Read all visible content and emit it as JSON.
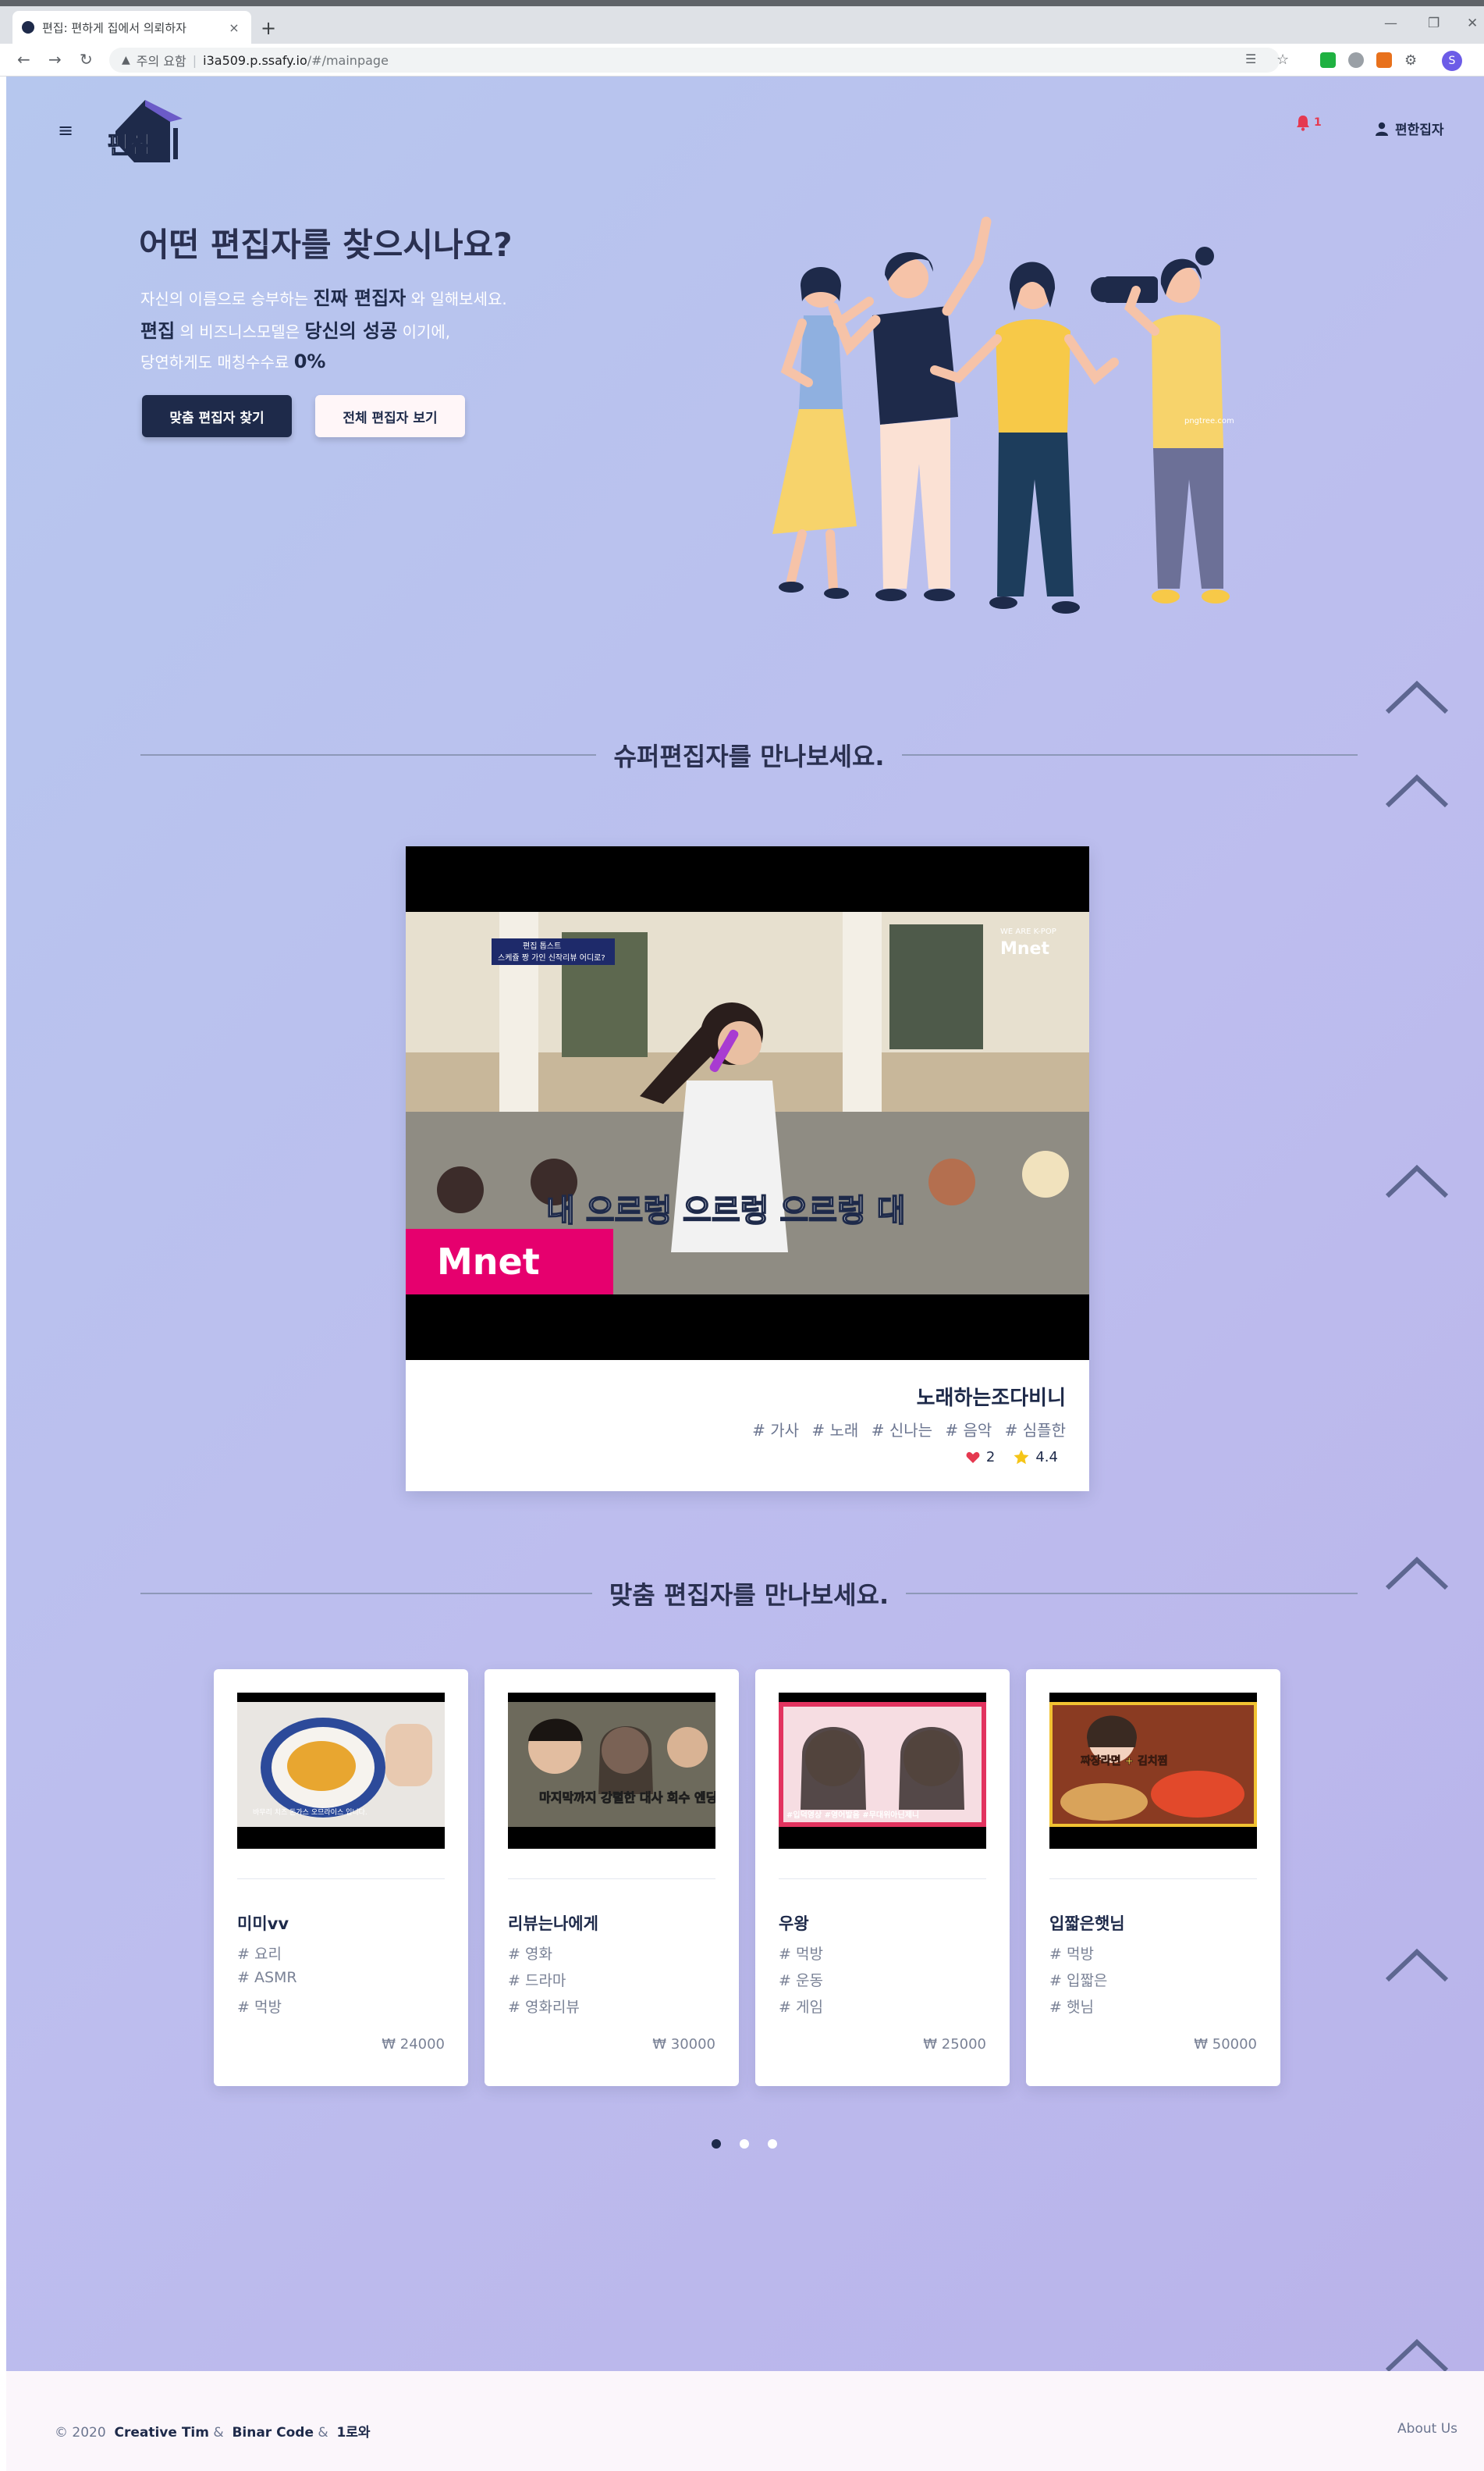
{
  "browser": {
    "tab_title": "편집: 편하게 집에서 의뢰하자",
    "tab_close": "×",
    "new_tab": "+",
    "security_label": "주의 요함",
    "separator": "|",
    "url_host": "i3a509.p.ssafy.io",
    "url_path": "/#/mainpage",
    "profile_initial": "S"
  },
  "navbar": {
    "logo_text": "편집",
    "notification_count": "1",
    "user_label": "편한집자"
  },
  "hero": {
    "title": "어떤 편집자를 찾으시나요?",
    "line1_pre": "자신의 이름으로 승부하는",
    "line1_bold": "진짜 편집자",
    "line1_post": "와 일해보세요.",
    "line2_bold1": "편집",
    "line2_mid": "의 비즈니스모델은",
    "line2_bold2": "당신의 성공",
    "line2_post": "이기에,",
    "line3_pre": "당연하게도 매칭수수료",
    "line3_bold": "0%",
    "btn_match": "맞춤 편집자 찾기",
    "btn_all": "전체 편집자 보기",
    "illustration_credit": "pngtree.com"
  },
  "super_section": {
    "heading": "슈퍼편집자를 만나보세요.",
    "video_caption": "내 으르렁 으르렁 으르렁 대",
    "video_logo": "Mnet",
    "video_badge_top": "편집 톱스트",
    "video_badge_bottom": "스케쥴 짱 가인 신작리뷰 어디로?",
    "channel_badge": "WE ARE K-POP",
    "editor_name": "노래하는조다비니",
    "tags": [
      "# 가사",
      "# 노래",
      "# 신나는",
      "# 음악",
      "# 심플한"
    ],
    "likes": "2",
    "rating": "4.4"
  },
  "match_section": {
    "heading": "맞춤 편집자를 만나보세요.",
    "cards": [
      {
        "name": "미미vv",
        "tags": [
          "# 요리",
          "# ASMR",
          "# 먹방"
        ],
        "price": "₩ 24000",
        "thumb_caption": "바무리 치즈 돈가스 오므라이스 입니다."
      },
      {
        "name": "리뷰는나에게",
        "tags": [
          "# 영화",
          "# 드라마",
          "# 영화리뷰"
        ],
        "price": "₩ 30000",
        "thumb_caption": "마지막까지 강렬한 대사 회수 엔딩"
      },
      {
        "name": "우왕",
        "tags": [
          "# 먹방",
          "# 운동",
          "# 게임"
        ],
        "price": "₩ 25000",
        "thumb_caption": "#입덕영상 #영어발음 #무대위아닌제니"
      },
      {
        "name": "입짧은햇님",
        "tags": [
          "# 먹방",
          "# 입짧은",
          "# 햇님"
        ],
        "price": "₩ 50000",
        "thumb_caption": "짜장라면 + 김치찜"
      }
    ],
    "carousel_dots": 3,
    "active_dot": 0
  },
  "footer": {
    "year": "© 2020",
    "author1": "Creative Tim",
    "amp1": "&",
    "author2": "Binar Code",
    "amp2": "&",
    "author3": "1로와",
    "about": "About Us"
  },
  "colors": {
    "primary": "#1e2a4a",
    "accent_red": "#e53950",
    "star": "#f5c518",
    "gradient_start": "#b6c7ee",
    "gradient_end": "#b9b3ea"
  }
}
